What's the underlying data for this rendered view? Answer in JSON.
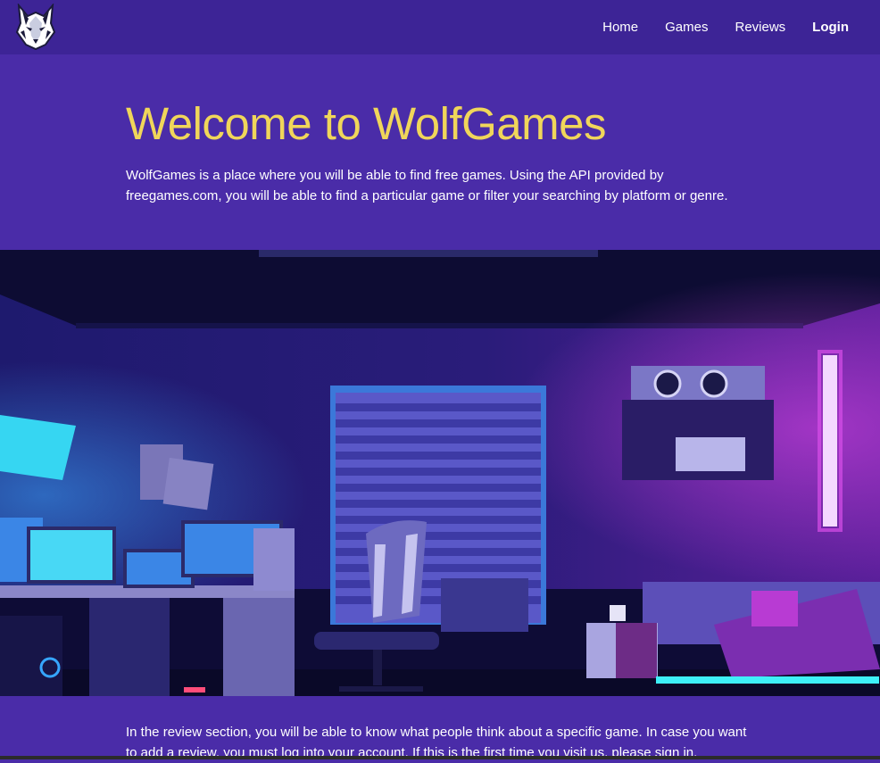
{
  "nav": {
    "logo_icon": "wolf-head-logo",
    "links": [
      "Home",
      "Games",
      "Reviews",
      "Login"
    ]
  },
  "hero": {
    "title": "Welcome to WolfGames",
    "description": "WolfGames is a place where you will be able to find free games. Using the API provided by freegames.com, you will be able to find a particular game or filter your searching by platform or genre."
  },
  "reviews": {
    "text": "In the review section, you will be able to know what people think about a specific game. In case you want to add a review, you must log into your account. If this is the first time you visit us, please sign in."
  },
  "colors": {
    "nav_bg": "#3d2496",
    "page_bg": "#4a2ca8",
    "title_yellow": "#f0d65a",
    "text": "#ffffff"
  }
}
